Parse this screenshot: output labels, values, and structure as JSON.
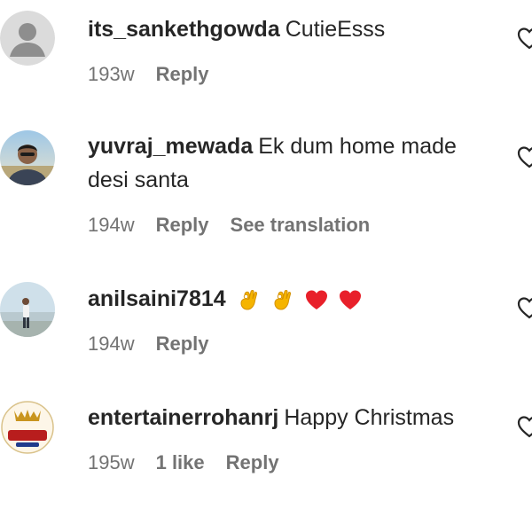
{
  "comments": [
    {
      "username": "its_sankethgowda",
      "text": "CutieEsss",
      "time": "193w",
      "reply_label": "Reply",
      "avatar": "default-avatar"
    },
    {
      "username": "yuvraj_mewada",
      "text_line1": "Ek dum home made",
      "text_line2": "desi santa",
      "time": "194w",
      "reply_label": "Reply",
      "translate_label": "See translation",
      "avatar": "photo-avatar-man"
    },
    {
      "username": "anilsaini7814",
      "emojis": [
        "ok-hand-emoji",
        "ok-hand-emoji",
        "red-heart-emoji",
        "red-heart-emoji"
      ],
      "time": "194w",
      "reply_label": "Reply",
      "avatar": "photo-avatar-beach"
    },
    {
      "username": "entertainerrohanrj",
      "text": "Happy Christmas",
      "time": "195w",
      "likes_label": "1 like",
      "reply_label": "Reply",
      "avatar": "logo-avatar"
    }
  ],
  "colors": {
    "primary_text": "#262626",
    "secondary_text": "#737373",
    "heart": "#e8202a",
    "ok_hand": "#f5b400"
  }
}
